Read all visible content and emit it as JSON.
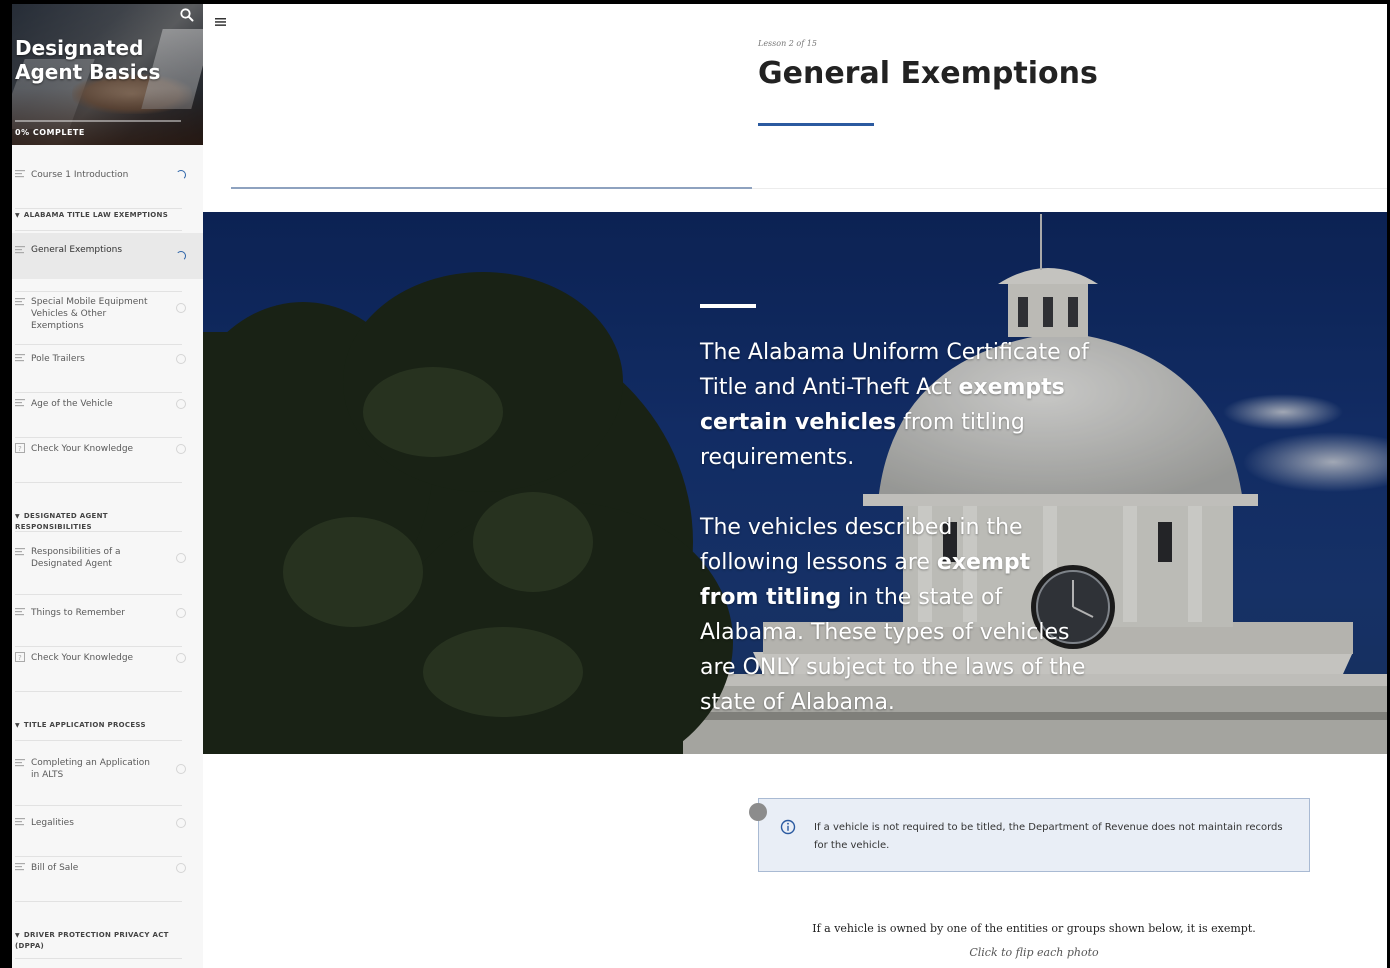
{
  "course": {
    "title": "Designated Agent Basics",
    "progress_text": "0% COMPLETE",
    "progress_fraction": 0
  },
  "sidebar": {
    "items": [
      {
        "kind": "lesson",
        "label": "Course 1 Introduction",
        "status": "in-progress",
        "icon": "lines-icon"
      },
      {
        "kind": "section",
        "label": "ALABAMA TITLE LAW EXEMPTIONS"
      },
      {
        "kind": "lesson",
        "label": "General Exemptions",
        "status": "in-progress",
        "icon": "lines-icon",
        "current": true
      },
      {
        "kind": "lesson",
        "label": "Special Mobile Equipment Vehicles & Other Exemptions",
        "status": "not-started",
        "icon": "lines-icon"
      },
      {
        "kind": "lesson",
        "label": "Pole Trailers",
        "status": "not-started",
        "icon": "lines-icon"
      },
      {
        "kind": "lesson",
        "label": "Age of the Vehicle",
        "status": "not-started",
        "icon": "lines-icon"
      },
      {
        "kind": "lesson",
        "label": "Check Your Knowledge",
        "status": "not-started",
        "icon": "quiz-icon"
      },
      {
        "kind": "section",
        "label": "DESIGNATED AGENT RESPONSIBILITIES"
      },
      {
        "kind": "lesson",
        "label": "Responsibilities of a Designated Agent",
        "status": "not-started",
        "icon": "lines-icon"
      },
      {
        "kind": "lesson",
        "label": "Things to Remember",
        "status": "not-started",
        "icon": "lines-icon"
      },
      {
        "kind": "lesson",
        "label": "Check Your Knowledge",
        "status": "not-started",
        "icon": "quiz-icon"
      },
      {
        "kind": "section",
        "label": "TITLE APPLICATION PROCESS"
      },
      {
        "kind": "lesson",
        "label": "Completing an Application in ALTS",
        "status": "not-started",
        "icon": "lines-icon"
      },
      {
        "kind": "lesson",
        "label": "Legalities",
        "status": "not-started",
        "icon": "lines-icon"
      },
      {
        "kind": "lesson",
        "label": "Bill of Sale",
        "status": "not-started",
        "icon": "lines-icon"
      },
      {
        "kind": "section",
        "label": "DRIVER PROTECTION PRIVACY ACT (DPPA)"
      }
    ]
  },
  "lesson": {
    "counter": "Lesson 2 of 15",
    "title": "General Exemptions"
  },
  "banner": {
    "p1": [
      {
        "t": "The Alabama Uniform Certificate of Title and Anti-Theft Act ",
        "b": false
      },
      {
        "t": "exempts certain vehicles",
        "b": true
      },
      {
        "t": " from titling requirements.",
        "b": false
      }
    ],
    "p2": [
      {
        "t": "The vehicles described in the following lessons are ",
        "b": false
      },
      {
        "t": "exempt from titling",
        "b": true
      },
      {
        "t": " in the state of Alabama. These types of vehicles are ONLY subject to the laws of the state of Alabama.",
        "b": false
      }
    ]
  },
  "callout": {
    "text": "If a vehicle is not required to be titled, the Department of Revenue does not maintain records for the vehicle."
  },
  "body": {
    "intro": "If a vehicle is owned by one of the entities or groups shown below, it is exempt.",
    "hint": "Click to flip each photo"
  },
  "colors": {
    "accent": "#2b5aa0",
    "callout_bg": "#e9eef6",
    "callout_border": "#a9bad3"
  }
}
